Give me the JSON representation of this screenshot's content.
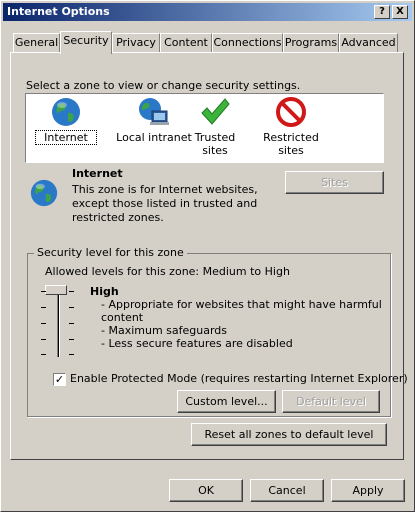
{
  "window": {
    "title": "Internet Options",
    "help_glyph": "?",
    "close_glyph": "X"
  },
  "tabs": [
    "General",
    "Security",
    "Privacy",
    "Content",
    "Connections",
    "Programs",
    "Advanced"
  ],
  "instructions": "Select a zone to view or change security settings.",
  "zones": [
    {
      "label": "Internet",
      "icon": "globe-icon"
    },
    {
      "label": "Local intranet",
      "icon": "intranet-icon"
    },
    {
      "label": "Trusted sites",
      "icon": "checkmark-icon"
    },
    {
      "label": "Restricted sites",
      "icon": "restricted-icon",
      "label_line1": "Restricted",
      "label_line2": "sites"
    }
  ],
  "selected_zone": {
    "name": "Internet",
    "description_lines": [
      "This zone is for Internet websites,",
      "except those listed in trusted and",
      "restricted zones."
    ]
  },
  "sites_button": "Sites",
  "security_level": {
    "group_title": "Security level for this zone",
    "allowed_levels": "Allowed levels for this zone: Medium to High",
    "level_name": "High",
    "bullets": [
      "- Appropriate for websites that might have harmful",
      "content",
      "- Maximum safeguards",
      "- Less secure features are disabled"
    ]
  },
  "protected_mode": {
    "label": "Enable Protected Mode (requires restarting Internet Explorer)",
    "checked": true,
    "check_glyph": "✓"
  },
  "custom_level_button": "Custom level...",
  "default_level_button": "Default level",
  "reset_all_button": "Reset all zones to default level",
  "footer": {
    "ok": "OK",
    "cancel": "Cancel",
    "apply": "Apply"
  },
  "colors": {
    "title_start": "#0a246a",
    "title_end": "#a6caf0",
    "face": "#d4d0c8"
  }
}
